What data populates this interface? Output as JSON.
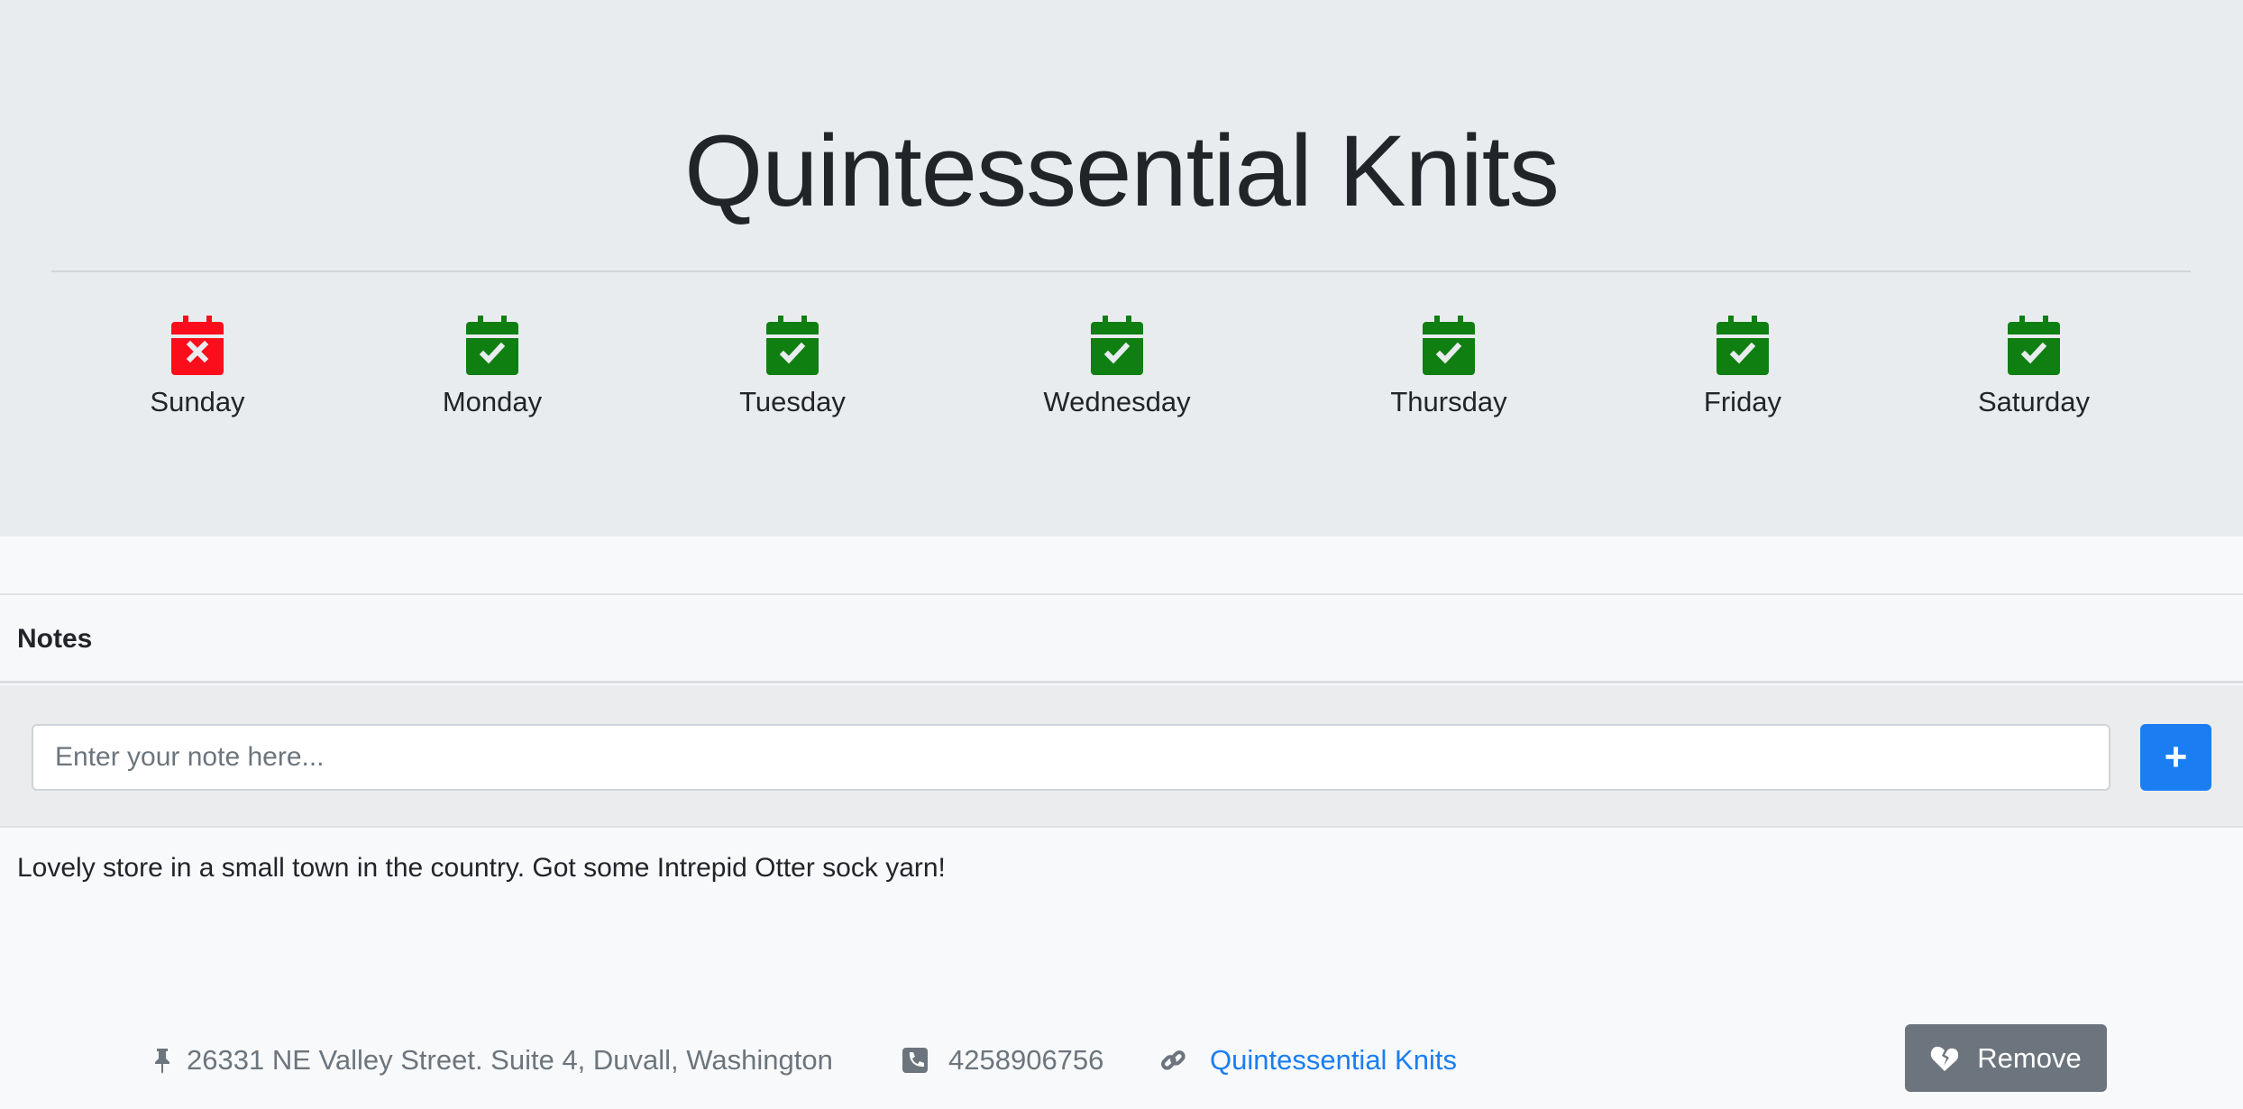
{
  "header": {
    "title": "Quintessential Knits"
  },
  "days": [
    {
      "label": "Sunday",
      "open": false
    },
    {
      "label": "Monday",
      "open": true
    },
    {
      "label": "Tuesday",
      "open": true
    },
    {
      "label": "Wednesday",
      "open": true
    },
    {
      "label": "Thursday",
      "open": true
    },
    {
      "label": "Friday",
      "open": true
    },
    {
      "label": "Saturday",
      "open": true
    }
  ],
  "colors": {
    "closed": "#fc0d1b",
    "open": "#107f12",
    "primary": "#1a7ef2",
    "secondary": "#6c757d"
  },
  "notes": {
    "heading": "Notes",
    "placeholder": "Enter your note here...",
    "add_label": "+",
    "items": [
      "Lovely store in a small town in the country. Got some Intrepid Otter sock yarn!"
    ]
  },
  "footer": {
    "address": "26331 NE Valley Street. Suite 4, Duvall, Washington",
    "phone": "4258906756",
    "website": "Quintessential Knits",
    "remove_label": "Remove"
  }
}
